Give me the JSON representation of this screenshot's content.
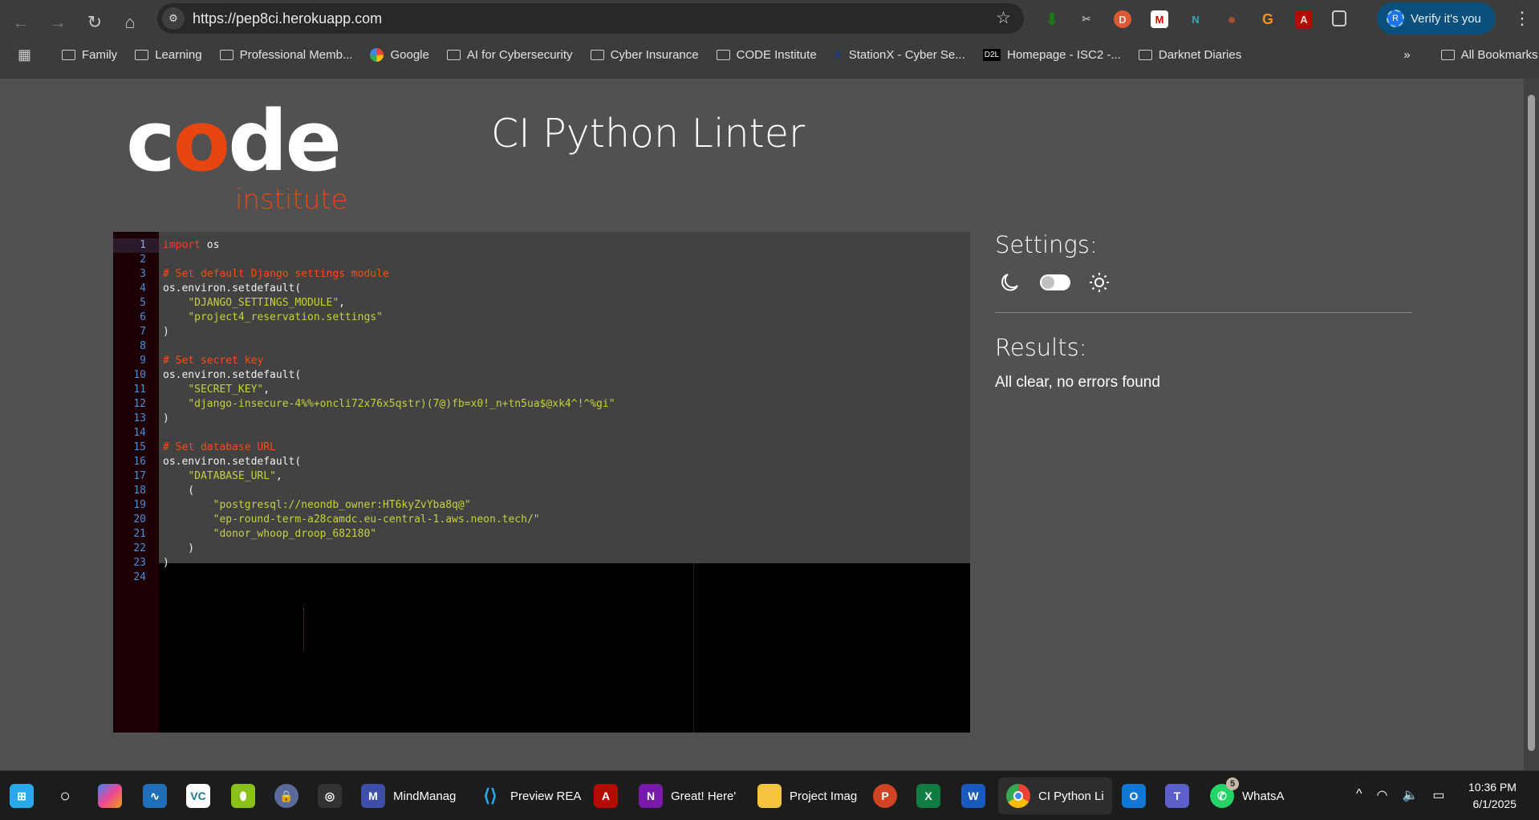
{
  "browser": {
    "url": "https://pep8ci.herokuapp.com",
    "verify_label": "Verify it's you",
    "avatar_initial": "R",
    "bookmarks": [
      "Family",
      "Learning",
      "Professional Memb...",
      "Google",
      "AI for Cybersecurity",
      "Cyber Insurance",
      "CODE Institute",
      "StationX - Cyber Se...",
      "Homepage - ISC2 -...",
      "Darknet Diaries"
    ],
    "more_bookmarks": "»",
    "all_bookmarks": "All Bookmarks"
  },
  "page": {
    "logo_top": "code",
    "logo_bottom": "institute",
    "title": "CI Python Linter",
    "settings_title": "Settings:",
    "results_title": "Results:",
    "results_text": "All clear, no errors found",
    "theme_toggle_dark": true
  },
  "editor": {
    "active_line": 1,
    "lines": [
      [
        [
          "kw",
          "import"
        ],
        [
          "id",
          " os"
        ]
      ],
      [],
      [
        [
          "cm",
          "# Set default Django settings module"
        ]
      ],
      [
        [
          "id",
          "os.environ.setdefault("
        ]
      ],
      [
        [
          "id",
          "    "
        ],
        [
          "str",
          "\"DJANGO_SETTINGS_MODULE\""
        ],
        [
          "id",
          ","
        ]
      ],
      [
        [
          "id",
          "    "
        ],
        [
          "str",
          "\"project4_reservation.settings\""
        ]
      ],
      [
        [
          "id",
          ")"
        ]
      ],
      [],
      [
        [
          "cm",
          "# Set secret key"
        ]
      ],
      [
        [
          "id",
          "os.environ.setdefault("
        ]
      ],
      [
        [
          "id",
          "    "
        ],
        [
          "str",
          "\"SECRET_KEY\""
        ],
        [
          "id",
          ","
        ]
      ],
      [
        [
          "id",
          "    "
        ],
        [
          "str",
          "\"django-insecure-4%%+oncli72x76x5qstr)(7@)fb=x0!_n+tn5ua$@xk4^!^%gi\""
        ]
      ],
      [
        [
          "id",
          ")"
        ]
      ],
      [],
      [
        [
          "cm",
          "# Set database URL"
        ]
      ],
      [
        [
          "id",
          "os.environ.setdefault("
        ]
      ],
      [
        [
          "id",
          "    "
        ],
        [
          "str",
          "\"DATABASE_URL\""
        ],
        [
          "id",
          ","
        ]
      ],
      [
        [
          "id",
          "    ("
        ]
      ],
      [
        [
          "id",
          "        "
        ],
        [
          "str",
          "\"postgresql://neondb_owner:HT6kyZvYba8q@\""
        ]
      ],
      [
        [
          "id",
          "        "
        ],
        [
          "str",
          "\"ep-round-term-a28camdc.eu-central-1.aws.neon.tech/\""
        ]
      ],
      [
        [
          "id",
          "        "
        ],
        [
          "str",
          "\"donor_whoop_droop_682180\""
        ]
      ],
      [
        [
          "id",
          "    )"
        ]
      ],
      [
        [
          "id",
          ")"
        ]
      ],
      []
    ]
  },
  "taskbar": {
    "apps": [
      {
        "name": "MindManager",
        "label": "MindManag"
      },
      {
        "name": "vscode",
        "label": "Preview REA"
      },
      {
        "name": "onenote",
        "label": "Great! Here'"
      },
      {
        "name": "file-explorer",
        "label": "Project Imag"
      },
      {
        "name": "chrome",
        "label": "CI Python Li"
      },
      {
        "name": "whatsapp",
        "label": "WhatsA",
        "badge": "5"
      }
    ],
    "time": "10:36 PM",
    "date": "6/1/2025"
  },
  "colors": {
    "accent": "#e84610",
    "page_bg": "#515151",
    "gutter": "#1d0005",
    "code_bg": "#424242",
    "comment": "#ff4a10",
    "string": "#c6d13a"
  }
}
